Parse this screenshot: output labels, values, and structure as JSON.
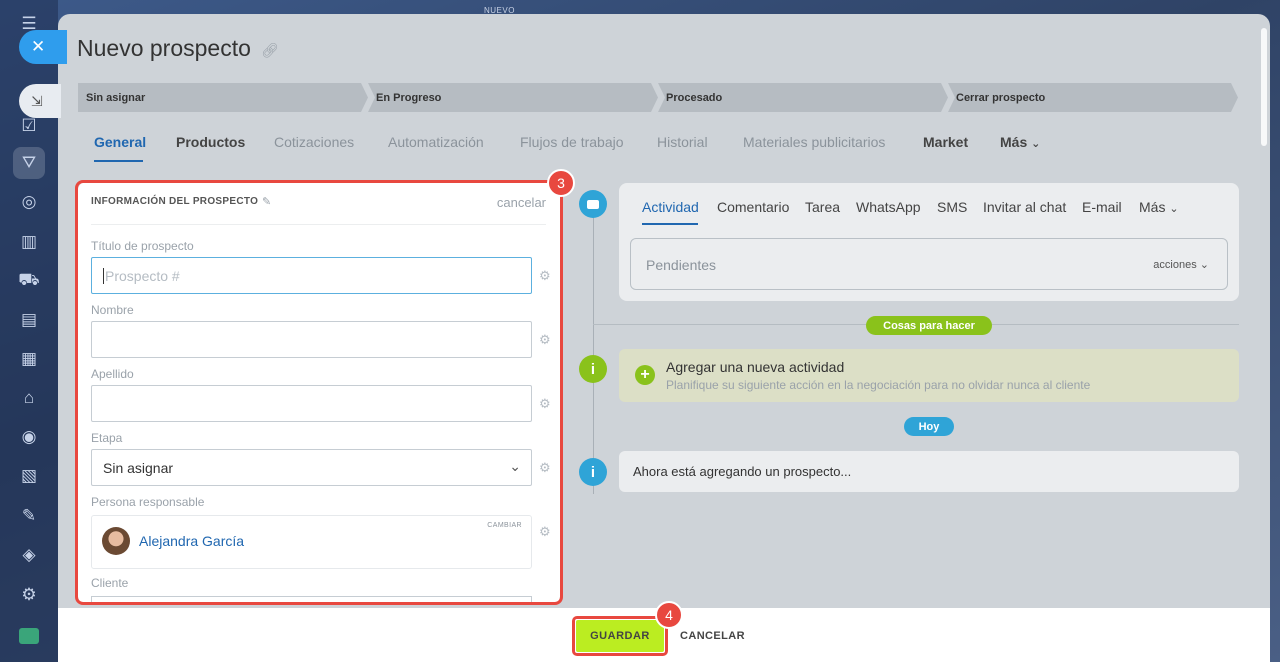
{
  "background": {
    "top_label": "NUEVO"
  },
  "sidebar": {
    "close_icon": "close-icon",
    "pin_icon": "pin-icon",
    "items": [
      "menu-icon",
      "feed-icon",
      "tasks-icon",
      "crm-icon",
      "robot-icon",
      "analytics-icon",
      "shop-icon",
      "contact-center-icon",
      "calendar-icon",
      "inventory-icon",
      "goals-icon",
      "documents-icon",
      "sign-icon",
      "delivery-icon",
      "settings-icon",
      "app-icon"
    ]
  },
  "page": {
    "title": "Nuevo prospecto",
    "link_icon": "link-icon"
  },
  "stages": [
    "Sin asignar",
    "En Progreso",
    "Procesado",
    "Cerrar prospecto"
  ],
  "tabs": [
    {
      "label": "General",
      "state": "active"
    },
    {
      "label": "Productos",
      "state": "dark"
    },
    {
      "label": "Cotizaciones",
      "state": "muted"
    },
    {
      "label": "Automatización",
      "state": "muted"
    },
    {
      "label": "Flujos de trabajo",
      "state": "muted"
    },
    {
      "label": "Historial",
      "state": "muted"
    },
    {
      "label": "Materiales publicitarios",
      "state": "muted"
    },
    {
      "label": "Market",
      "state": "dark"
    },
    {
      "label": "Más",
      "state": "dark"
    }
  ],
  "form": {
    "heading": "INFORMACIÓN DEL PROSPECTO",
    "cancel": "cancelar",
    "title_label": "Título de prospecto",
    "title_placeholder": "Prospecto #",
    "name_label": "Nombre",
    "name_value": "",
    "surname_label": "Apellido",
    "surname_value": "",
    "stage_label": "Etapa",
    "stage_value": "Sin asignar",
    "responsible_label": "Persona responsable",
    "responsible_change": "CAMBIAR",
    "responsible_name": "Alejandra García",
    "client_label": "Cliente"
  },
  "badges": {
    "form": "3",
    "save": "4"
  },
  "activity": {
    "tabs": [
      "Actividad",
      "Comentario",
      "Tarea",
      "WhatsApp",
      "SMS",
      "Invitar al chat",
      "E-mail",
      "Más"
    ],
    "pending": "Pendientes",
    "actions": "acciones",
    "todo_pill": "Cosas para hacer",
    "new_title": "Agregar una nueva actividad",
    "new_subtitle": "Planifique su siguiente acción en la negociación para no olvidar nunca al cliente",
    "today_pill": "Hoy",
    "now_text": "Ahora está agregando un prospecto..."
  },
  "footer": {
    "save": "GUARDAR",
    "cancel": "CANCELAR"
  },
  "colors": {
    "accent": "#2067b0",
    "save": "#bbed21",
    "highlight": "#e8483f",
    "success": "#8ac21b",
    "info": "#2fa4d7"
  }
}
